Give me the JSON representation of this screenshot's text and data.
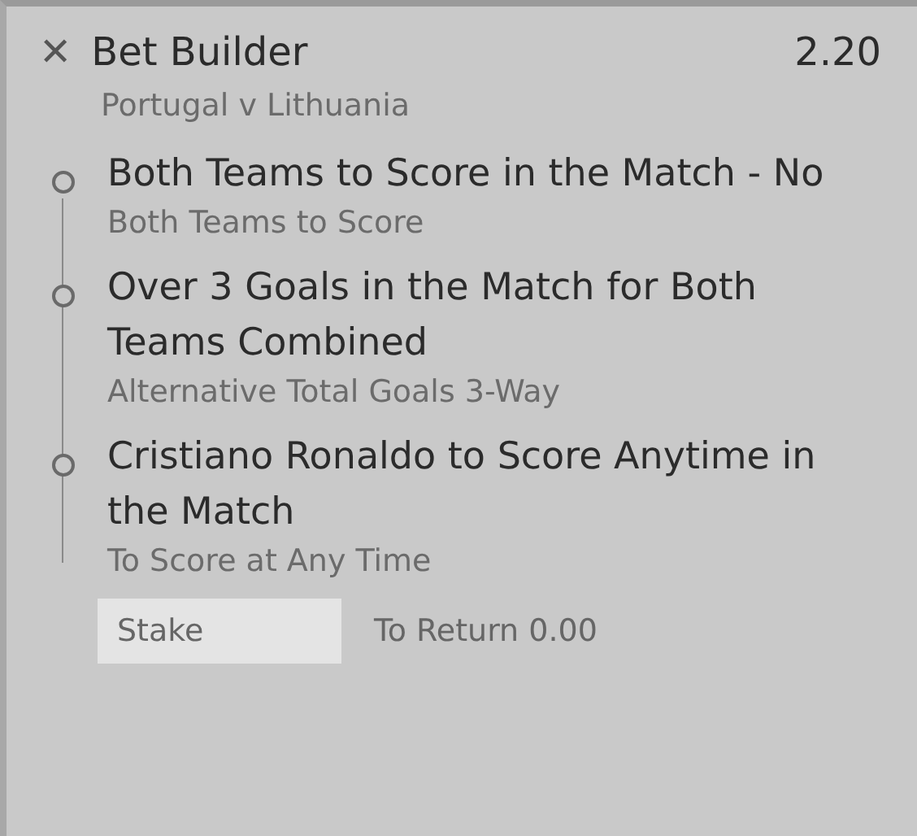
{
  "bet": {
    "close_icon": "✕",
    "title": "Bet Builder",
    "odds": "2.20",
    "match": "Portugal v Lithuania"
  },
  "selections": [
    {
      "name": "Both Teams to Score in the Match - No",
      "market": "Both Teams to Score"
    },
    {
      "name": "Over 3 Goals in the Match for Both Teams Combined",
      "market": "Alternative Total Goals 3-Way"
    },
    {
      "name": "Cristiano Ronaldo to Score Anytime in the Match",
      "market": "To Score at Any Time"
    }
  ],
  "stake": {
    "placeholder": "Stake"
  },
  "to_return": "To Return 0.00"
}
